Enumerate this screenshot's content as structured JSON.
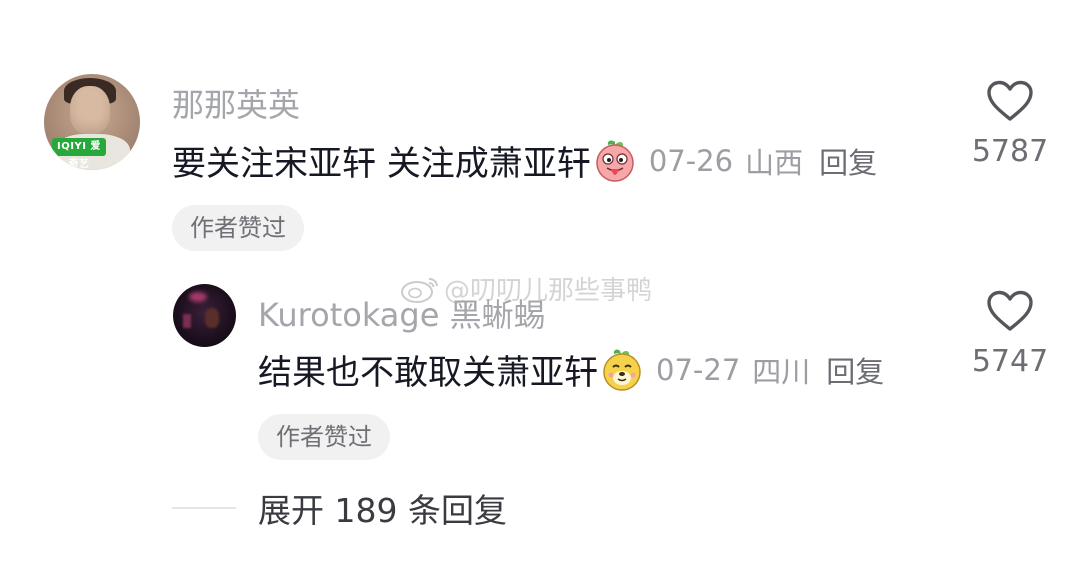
{
  "comments": [
    {
      "username": "那那英英",
      "text": "要关注宋亚轩 关注成萧亚轩",
      "emoji_icon": "peach-tongue-emoji",
      "date": "07-26",
      "location": "山西",
      "reply_label": "回复",
      "author_liked": "作者赞过",
      "like_icon": "heart-outline-icon",
      "like_count": "5787",
      "avatar_badge": "IQIYI 爱奇艺"
    },
    {
      "username": "Kurotokage 黑蜥蜴",
      "text": "结果也不敢取关萧亚轩",
      "emoji_icon": "yellow-dog-emoji",
      "date": "07-27",
      "location": "四川",
      "reply_label": "回复",
      "author_liked": "作者赞过",
      "like_icon": "heart-outline-icon",
      "like_count": "5747"
    }
  ],
  "watermark": "@叨叨儿那些事鸭",
  "expand_replies": "展开 189 条回复"
}
